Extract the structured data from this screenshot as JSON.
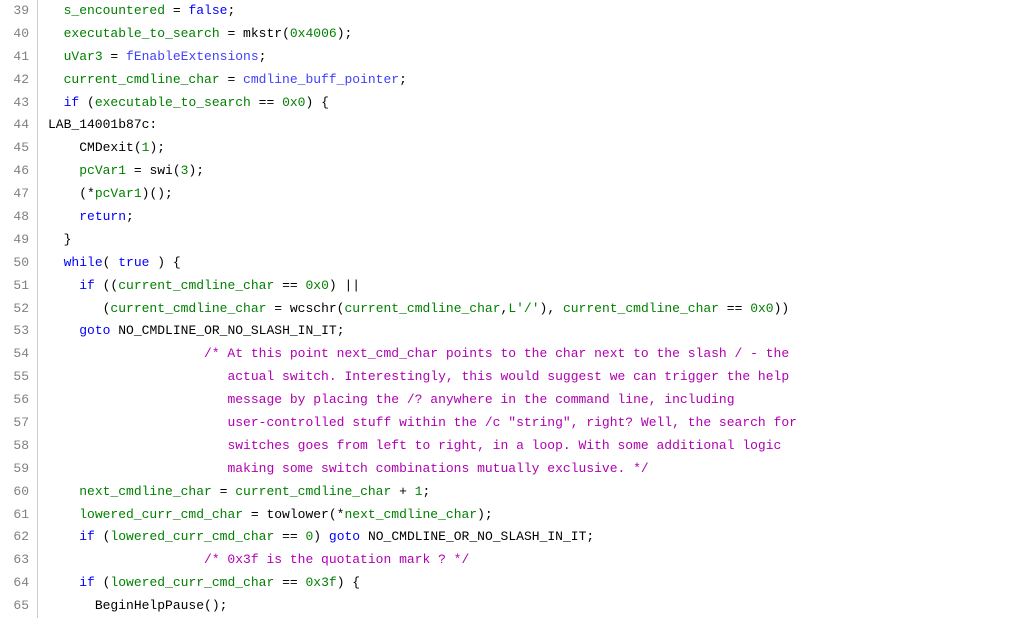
{
  "lines": [
    {
      "num": "39",
      "indent": "  ",
      "tokens": [
        {
          "t": "s_encountered",
          "c": "var"
        },
        {
          "t": " = ",
          "c": "punct"
        },
        {
          "t": "false",
          "c": "kw"
        },
        {
          "t": ";",
          "c": "punct"
        }
      ]
    },
    {
      "num": "40",
      "indent": "  ",
      "tokens": [
        {
          "t": "executable_to_search",
          "c": "var"
        },
        {
          "t": " = ",
          "c": "punct"
        },
        {
          "t": "mkstr",
          "c": "func"
        },
        {
          "t": "(",
          "c": "punct"
        },
        {
          "t": "0x4006",
          "c": "num"
        },
        {
          "t": ");",
          "c": "punct"
        }
      ]
    },
    {
      "num": "41",
      "indent": "  ",
      "tokens": [
        {
          "t": "uVar3",
          "c": "var"
        },
        {
          "t": " = ",
          "c": "punct"
        },
        {
          "t": "fEnableExtensions",
          "c": "globalvar"
        },
        {
          "t": ";",
          "c": "punct"
        }
      ]
    },
    {
      "num": "42",
      "indent": "  ",
      "tokens": [
        {
          "t": "current_cmdline_char",
          "c": "var"
        },
        {
          "t": " = ",
          "c": "punct"
        },
        {
          "t": "cmdline_buff_pointer",
          "c": "globalvar"
        },
        {
          "t": ";",
          "c": "punct"
        }
      ]
    },
    {
      "num": "43",
      "indent": "  ",
      "tokens": [
        {
          "t": "if",
          "c": "kw"
        },
        {
          "t": " (",
          "c": "punct"
        },
        {
          "t": "executable_to_search",
          "c": "var"
        },
        {
          "t": " == ",
          "c": "punct"
        },
        {
          "t": "0x0",
          "c": "num"
        },
        {
          "t": ") {",
          "c": "punct"
        }
      ]
    },
    {
      "num": "44",
      "indent": "",
      "tokens": [
        {
          "t": "LAB_14001b87c:",
          "c": "label"
        }
      ]
    },
    {
      "num": "45",
      "indent": "    ",
      "tokens": [
        {
          "t": "CMDexit",
          "c": "func"
        },
        {
          "t": "(",
          "c": "punct"
        },
        {
          "t": "1",
          "c": "num"
        },
        {
          "t": ");",
          "c": "punct"
        }
      ]
    },
    {
      "num": "46",
      "indent": "    ",
      "tokens": [
        {
          "t": "pcVar1",
          "c": "var"
        },
        {
          "t": " = ",
          "c": "punct"
        },
        {
          "t": "swi",
          "c": "func"
        },
        {
          "t": "(",
          "c": "punct"
        },
        {
          "t": "3",
          "c": "num"
        },
        {
          "t": ");",
          "c": "punct"
        }
      ]
    },
    {
      "num": "47",
      "indent": "    ",
      "tokens": [
        {
          "t": "(*",
          "c": "punct"
        },
        {
          "t": "pcVar1",
          "c": "var"
        },
        {
          "t": ")();",
          "c": "punct"
        }
      ]
    },
    {
      "num": "48",
      "indent": "    ",
      "tokens": [
        {
          "t": "return",
          "c": "kw"
        },
        {
          "t": ";",
          "c": "punct"
        }
      ]
    },
    {
      "num": "49",
      "indent": "  ",
      "tokens": [
        {
          "t": "}",
          "c": "punct"
        }
      ]
    },
    {
      "num": "50",
      "indent": "  ",
      "tokens": [
        {
          "t": "while",
          "c": "kw"
        },
        {
          "t": "( ",
          "c": "punct"
        },
        {
          "t": "true",
          "c": "kw"
        },
        {
          "t": " ) {",
          "c": "punct"
        }
      ]
    },
    {
      "num": "51",
      "indent": "    ",
      "tokens": [
        {
          "t": "if",
          "c": "kw"
        },
        {
          "t": " ((",
          "c": "punct"
        },
        {
          "t": "current_cmdline_char",
          "c": "var"
        },
        {
          "t": " == ",
          "c": "punct"
        },
        {
          "t": "0x0",
          "c": "num"
        },
        {
          "t": ") ||",
          "c": "punct"
        }
      ]
    },
    {
      "num": "52",
      "indent": "       ",
      "tokens": [
        {
          "t": "(",
          "c": "punct"
        },
        {
          "t": "current_cmdline_char",
          "c": "var"
        },
        {
          "t": " = ",
          "c": "punct"
        },
        {
          "t": "wcschr",
          "c": "func"
        },
        {
          "t": "(",
          "c": "punct"
        },
        {
          "t": "current_cmdline_char",
          "c": "var"
        },
        {
          "t": ",",
          "c": "punct"
        },
        {
          "t": "L'/'",
          "c": "str"
        },
        {
          "t": "), ",
          "c": "punct"
        },
        {
          "t": "current_cmdline_char",
          "c": "var"
        },
        {
          "t": " == ",
          "c": "punct"
        },
        {
          "t": "0x0",
          "c": "num"
        },
        {
          "t": "))",
          "c": "punct"
        }
      ]
    },
    {
      "num": "53",
      "indent": "    ",
      "tokens": [
        {
          "t": "goto",
          "c": "kw"
        },
        {
          "t": " ",
          "c": "punct"
        },
        {
          "t": "NO_CMDLINE_OR_NO_SLASH_IN_IT",
          "c": "gotolabel"
        },
        {
          "t": ";",
          "c": "punct"
        }
      ]
    },
    {
      "num": "54",
      "indent": "                    ",
      "tokens": [
        {
          "t": "/* At this point next_cmd_char points to the char next to the slash / - the",
          "c": "comment"
        }
      ]
    },
    {
      "num": "55",
      "indent": "                       ",
      "tokens": [
        {
          "t": "actual switch. Interestingly, this would suggest we can trigger the help",
          "c": "comment"
        }
      ]
    },
    {
      "num": "56",
      "indent": "                       ",
      "tokens": [
        {
          "t": "message by placing the /? anywhere in the command line, including",
          "c": "comment"
        }
      ]
    },
    {
      "num": "57",
      "indent": "                       ",
      "tokens": [
        {
          "t": "user-controlled stuff within the /c \"string\", right? Well, the search for",
          "c": "comment"
        }
      ]
    },
    {
      "num": "58",
      "indent": "                       ",
      "tokens": [
        {
          "t": "switches goes from left to right, in a loop. With some additional logic",
          "c": "comment"
        }
      ]
    },
    {
      "num": "59",
      "indent": "                       ",
      "tokens": [
        {
          "t": "making some switch combinations mutually exclusive. */",
          "c": "comment"
        }
      ]
    },
    {
      "num": "60",
      "indent": "    ",
      "tokens": [
        {
          "t": "next_cmdline_char",
          "c": "var"
        },
        {
          "t": " = ",
          "c": "punct"
        },
        {
          "t": "current_cmdline_char",
          "c": "var"
        },
        {
          "t": " + ",
          "c": "punct"
        },
        {
          "t": "1",
          "c": "num"
        },
        {
          "t": ";",
          "c": "punct"
        }
      ]
    },
    {
      "num": "61",
      "indent": "    ",
      "tokens": [
        {
          "t": "lowered_curr_cmd_char",
          "c": "var"
        },
        {
          "t": " = ",
          "c": "punct"
        },
        {
          "t": "towlower",
          "c": "func"
        },
        {
          "t": "(*",
          "c": "punct"
        },
        {
          "t": "next_cmdline_char",
          "c": "var"
        },
        {
          "t": ");",
          "c": "punct"
        }
      ]
    },
    {
      "num": "62",
      "indent": "    ",
      "tokens": [
        {
          "t": "if",
          "c": "kw"
        },
        {
          "t": " (",
          "c": "punct"
        },
        {
          "t": "lowered_curr_cmd_char",
          "c": "var"
        },
        {
          "t": " == ",
          "c": "punct"
        },
        {
          "t": "0",
          "c": "num"
        },
        {
          "t": ") ",
          "c": "punct"
        },
        {
          "t": "goto",
          "c": "kw"
        },
        {
          "t": " ",
          "c": "punct"
        },
        {
          "t": "NO_CMDLINE_OR_NO_SLASH_IN_IT",
          "c": "gotolabel"
        },
        {
          "t": ";",
          "c": "punct"
        }
      ]
    },
    {
      "num": "63",
      "indent": "                    ",
      "tokens": [
        {
          "t": "/* 0x3f is the quotation mark ? */",
          "c": "comment"
        }
      ]
    },
    {
      "num": "64",
      "indent": "    ",
      "tokens": [
        {
          "t": "if",
          "c": "kw"
        },
        {
          "t": " (",
          "c": "punct"
        },
        {
          "t": "lowered_curr_cmd_char",
          "c": "var"
        },
        {
          "t": " == ",
          "c": "punct"
        },
        {
          "t": "0x3f",
          "c": "num"
        },
        {
          "t": ") {",
          "c": "punct"
        }
      ]
    },
    {
      "num": "65",
      "indent": "      ",
      "tokens": [
        {
          "t": "BeginHelpPause",
          "c": "func"
        },
        {
          "t": "();",
          "c": "punct"
        }
      ]
    }
  ]
}
